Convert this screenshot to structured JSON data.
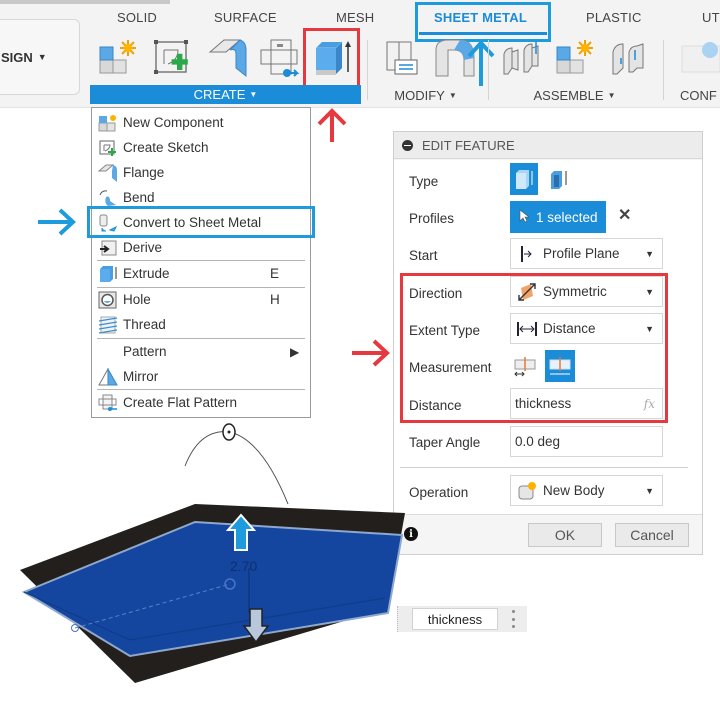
{
  "toolbar": {
    "workspace_button": "SIGN",
    "tabs": [
      {
        "label": "SOLID",
        "active": false
      },
      {
        "label": "SURFACE",
        "active": false
      },
      {
        "label": "MESH",
        "active": false
      },
      {
        "label": "SHEET METAL",
        "active": true
      },
      {
        "label": "PLASTIC",
        "active": false
      },
      {
        "label": "UT",
        "active": false
      }
    ],
    "groups": {
      "create": "CREATE",
      "modify": "MODIFY",
      "assemble": "ASSEMBLE",
      "configure": "CONF"
    },
    "create_tools": [
      "new-component",
      "create-sketch",
      "flange",
      "create-flat-pattern",
      "extrude"
    ],
    "modify_tools": [
      "derive",
      "bend"
    ],
    "assemble_tools": [
      "joint",
      "new-component",
      "as-built-joint"
    ],
    "configure_tools": [
      "configure"
    ]
  },
  "create_menu": {
    "items": [
      {
        "label": "New Component",
        "icon": "new-component",
        "shortcut": ""
      },
      {
        "label": "Create Sketch",
        "icon": "create-sketch",
        "shortcut": ""
      },
      {
        "label": "Flange",
        "icon": "flange",
        "shortcut": ""
      },
      {
        "label": "Bend",
        "icon": "bend",
        "shortcut": ""
      },
      {
        "label": "Convert to Sheet Metal",
        "icon": "convert-sheet-metal",
        "shortcut": "",
        "highlighted": true
      },
      {
        "label": "Derive",
        "icon": "derive",
        "shortcut": ""
      },
      {
        "label": "Extrude",
        "icon": "extrude",
        "shortcut": "E"
      },
      {
        "label": "Hole",
        "icon": "hole",
        "shortcut": "H"
      },
      {
        "label": "Thread",
        "icon": "thread",
        "shortcut": ""
      },
      {
        "label": "Pattern",
        "icon": "",
        "shortcut": "",
        "submenu": true
      },
      {
        "label": "Mirror",
        "icon": "mirror",
        "shortcut": ""
      },
      {
        "label": "Create Flat Pattern",
        "icon": "flat-pattern",
        "shortcut": ""
      }
    ]
  },
  "edit_feature": {
    "title": "EDIT FEATURE",
    "type_label": "Type",
    "profiles_label": "Profiles",
    "profiles_value": "1 selected",
    "start_label": "Start",
    "start_value": "Profile Plane",
    "direction_label": "Direction",
    "direction_value": "Symmetric",
    "extent_type_label": "Extent Type",
    "extent_type_value": "Distance",
    "measurement_label": "Measurement",
    "distance_label": "Distance",
    "distance_value": "thickness",
    "distance_fx": "fx",
    "taper_angle_label": "Taper Angle",
    "taper_angle_value": "0.0 deg",
    "operation_label": "Operation",
    "operation_value": "New Body",
    "ok_label": "OK",
    "cancel_label": "Cancel"
  },
  "viewport": {
    "dimension_text": "2.70",
    "thickness_input": "thickness"
  },
  "colors": {
    "accent": "#1a8cd8",
    "highlight_blue": "#1e9bdc",
    "highlight_red": "#e6393f",
    "body_face": "#1446a0",
    "body_edge": "#231f1c"
  }
}
